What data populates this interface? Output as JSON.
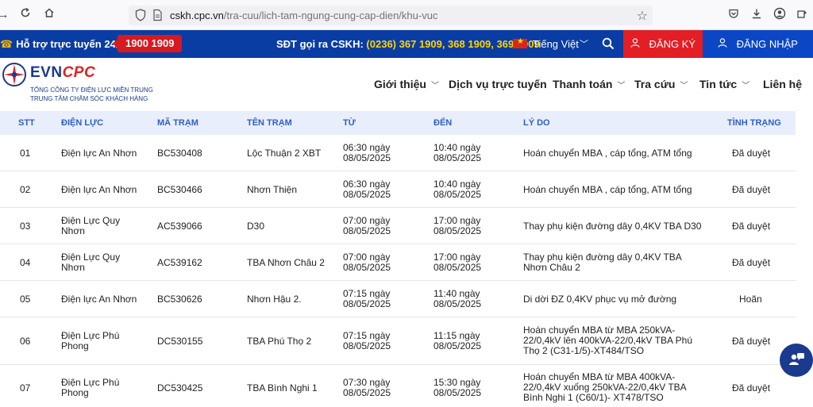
{
  "browser": {
    "url_host": "cskh.cpc.vn",
    "url_path": "/tra-cuu/lich-tam-ngung-cung-cap-dien/khu-vuc"
  },
  "topbar": {
    "support_label": "Hỗ trợ trực tuyến 24/7:",
    "hotline": "1900 1909",
    "cskh_label": "SĐT gọi ra CSKH:",
    "cskh_numbers": "(0236) 367 1909, 368 1909, 369 1909",
    "language": "Tiếng Việt",
    "register_label": "ĐĂNG KÝ",
    "login_label": "ĐĂNG NHẬP"
  },
  "header": {
    "brand_evn": "EVN",
    "brand_cpc": "CPC",
    "org_line1": "TỔNG CÔNG TY ĐIỆN LỰC MIỀN TRUNG",
    "org_line2": "TRUNG TÂM CHĂM SÓC KHÁCH HÀNG",
    "menu": [
      {
        "label": "Giới thiệu",
        "has_dropdown": true
      },
      {
        "label": "Dịch vụ trực tuyến",
        "has_dropdown": false
      },
      {
        "label": "Thanh toán",
        "has_dropdown": true
      },
      {
        "label": "Tra cứu",
        "has_dropdown": true
      },
      {
        "label": "Tin tức",
        "has_dropdown": true
      },
      {
        "label": "Liên hệ",
        "has_dropdown": false
      }
    ]
  },
  "table": {
    "columns": [
      "STT",
      "ĐIỆN LỰC",
      "MÃ TRẠM",
      "TÊN TRẠM",
      "TỪ",
      "ĐẾN",
      "LÝ DO",
      "TÌNH TRẠNG"
    ],
    "rows": [
      {
        "stt": "01",
        "dien_luc": "Điện lực An Nhơn",
        "ma_tram": "BC530408",
        "ten_tram": "Lộc Thuận 2 XBT",
        "tu": "06:30 ngày 08/05/2025",
        "den": "10:40 ngày 08/05/2025",
        "ly_do": "Hoán chuyển MBA , cáp tổng, ATM tổng",
        "tinh_trang": "Đã duyệt"
      },
      {
        "stt": "02",
        "dien_luc": "Điện lực An Nhơn",
        "ma_tram": "BC530466",
        "ten_tram": "Nhơn Thiện",
        "tu": "06:30 ngày 08/05/2025",
        "den": "10:40 ngày 08/05/2025",
        "ly_do": "Hoán chuyển MBA , cáp tổng, ATM tổng",
        "tinh_trang": "Đã duyệt"
      },
      {
        "stt": "03",
        "dien_luc": "Điện Lực Quy Nhơn",
        "ma_tram": "AC539066",
        "ten_tram": "D30",
        "tu": "07:00 ngày 08/05/2025",
        "den": "17:00 ngày 08/05/2025",
        "ly_do": "Thay phụ kiện đường dây 0,4KV TBA D30",
        "tinh_trang": "Đã duyệt"
      },
      {
        "stt": "04",
        "dien_luc": "Điện Lực Quy Nhơn",
        "ma_tram": "AC539162",
        "ten_tram": "TBA Nhơn Châu 2",
        "tu": "07:00 ngày 08/05/2025",
        "den": "17:00 ngày 08/05/2025",
        "ly_do": "Thay phụ kiện đường dây 0,4KV TBA Nhơn Châu 2",
        "tinh_trang": "Đã duyệt"
      },
      {
        "stt": "05",
        "dien_luc": "Điện lực An Nhơn",
        "ma_tram": "BC530626",
        "ten_tram": "Nhơn Hậu 2.",
        "tu": "07:15 ngày 08/05/2025",
        "den": "11:40 ngày 08/05/2025",
        "ly_do": "Di dời ĐZ 0,4KV phục vụ mở đường",
        "tinh_trang": "Hoãn"
      },
      {
        "stt": "06",
        "dien_luc": "Điện Lực Phú Phong",
        "ma_tram": "DC530155",
        "ten_tram": "TBA Phú Thọ 2",
        "tu": "07:15 ngày 08/05/2025",
        "den": "11:15 ngày 08/05/2025",
        "ly_do": "Hoán chuyển MBA từ MBA 250kVA-22/0,4kV lên 400kVA-22/0,4kV TBA Phú Thọ 2 (C31-1/5)-XT484/TSO",
        "tinh_trang": "Đã duyệt"
      },
      {
        "stt": "07",
        "dien_luc": "Điện Lực Phú Phong",
        "ma_tram": "DC530425",
        "ten_tram": "TBA Bình Nghi 1",
        "tu": "07:30 ngày 08/05/2025",
        "den": "15:30 ngày 08/05/2025",
        "ly_do": "Hoán chuyển MBA từ MBA 400kVA-22/0,4kV xuống 250kVA-22/0,4kV TBA Bình Nghi 1 (C60/1)- XT478/TSO",
        "tinh_trang": "Đã duyệt"
      }
    ]
  }
}
